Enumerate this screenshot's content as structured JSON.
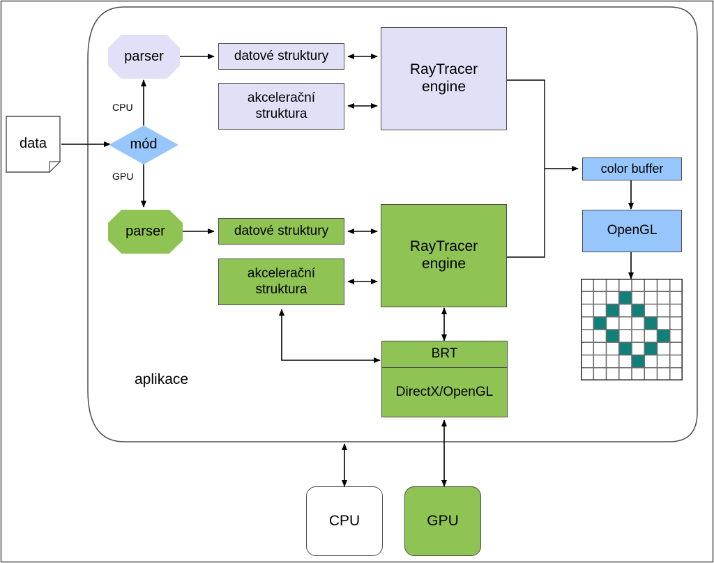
{
  "diagram": {
    "title_label": "aplikace",
    "colors": {
      "lavender": "#e2e0f7",
      "green": "#8fc455",
      "blue": "#96c6fb",
      "white": "#ffffff",
      "stroke": "#4d4d4d",
      "pixel_fill": "#11807a",
      "grid_line": "#6b6b6b"
    },
    "nodes": {
      "data": "data",
      "mode": "mód",
      "mode_branch_cpu": "CPU",
      "mode_branch_gpu": "GPU",
      "cpu_parser": "parser",
      "cpu_data_structures": "datové struktury",
      "cpu_accel_structure": "akcelerační\nstruktura",
      "cpu_accel_line1": "akcelerační",
      "cpu_accel_line2": "struktura",
      "cpu_raytracer_line1": "RayTracer",
      "cpu_raytracer_line2": "engine",
      "gpu_parser": "parser",
      "gpu_data_structures": "datové struktury",
      "gpu_accel_line1": "akcelerační",
      "gpu_accel_line2": "struktura",
      "gpu_raytracer_line1": "RayTracer",
      "gpu_raytracer_line2": "engine",
      "brt": "BRT",
      "directx_opengl": "DirectX/OpenGL",
      "color_buffer": "color buffer",
      "opengl": "OpenGL",
      "cpu_chip": "CPU",
      "gpu_chip": "GPU"
    },
    "pixel_grid": {
      "rows": 8,
      "cols": 8,
      "filled_cells": [
        [
          1,
          3
        ],
        [
          2,
          2
        ],
        [
          2,
          4
        ],
        [
          3,
          1
        ],
        [
          3,
          5
        ],
        [
          4,
          2
        ],
        [
          4,
          6
        ],
        [
          5,
          3
        ],
        [
          5,
          5
        ],
        [
          6,
          4
        ]
      ]
    }
  }
}
